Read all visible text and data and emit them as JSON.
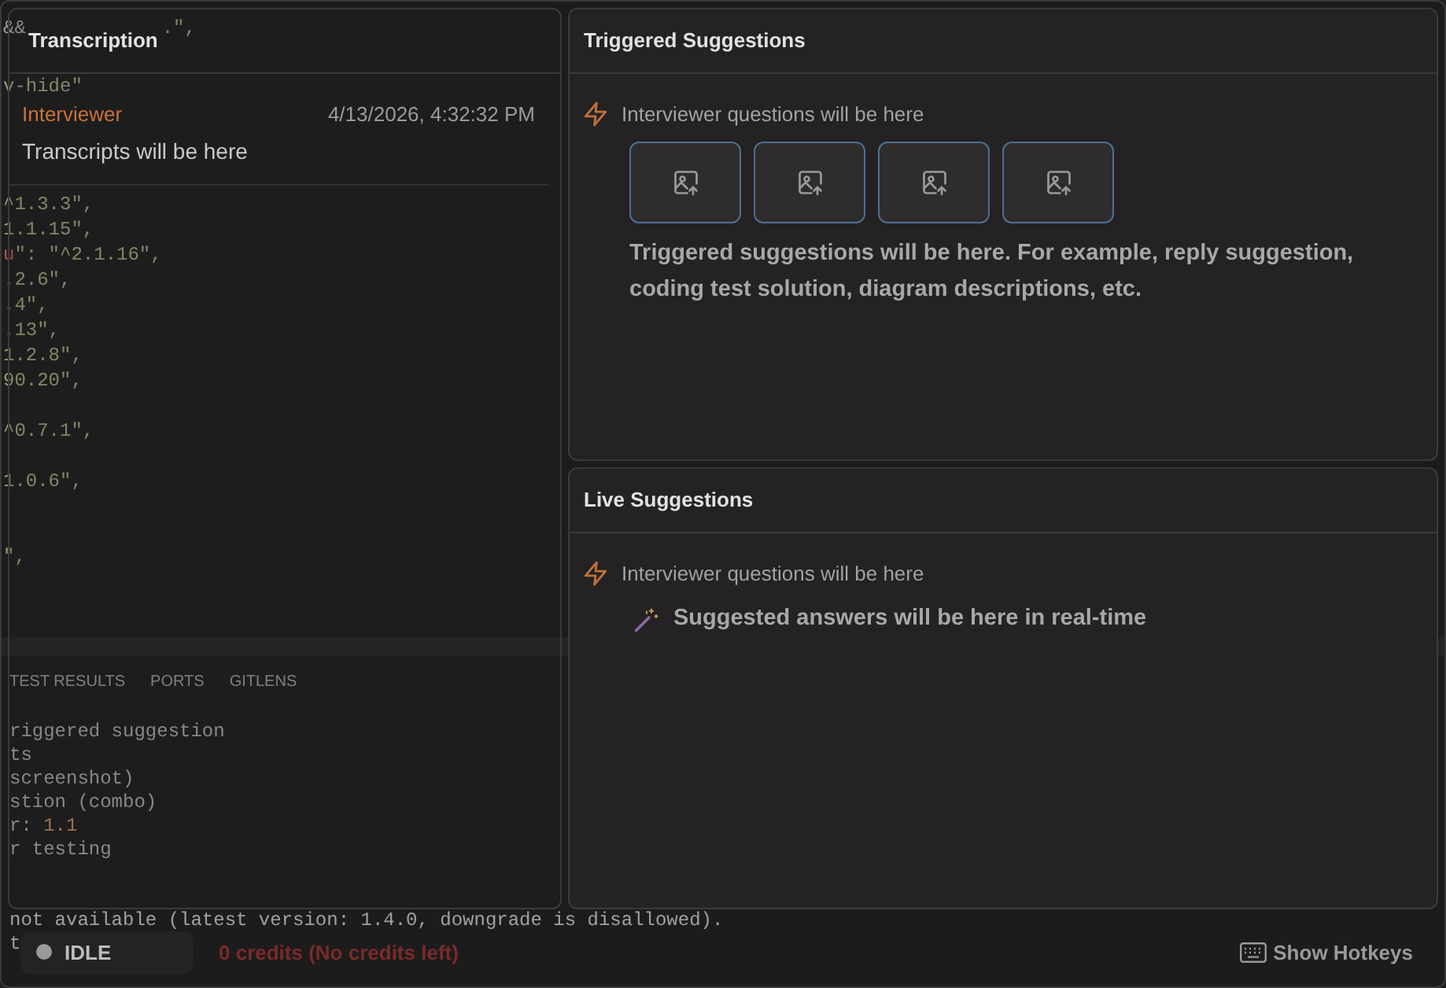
{
  "background_editor": {
    "code_blocks": [
      [
        [
          {
            "text": "&&",
            "kind": "plain"
          },
          {
            "text": "            .\",",
            "kind": "string"
          }
        ]
      ],
      [
        [
          {
            "text": "v-hide\"",
            "kind": "string"
          }
        ]
      ],
      [
        [
          {
            "text": "^1.3.3\",",
            "kind": "string"
          }
        ],
        [
          {
            "text": "1.1.15\",",
            "kind": "string"
          }
        ],
        [
          {
            "text": "u",
            "kind": "key"
          },
          {
            "text": "\": \"^2.1.16\",",
            "kind": "string"
          }
        ],
        [
          {
            "text": ".2.6\",",
            "kind": "string"
          }
        ],
        [
          {
            "text": ".4\",",
            "kind": "string"
          }
        ],
        [
          {
            "text": ".13\",",
            "kind": "string"
          }
        ],
        [
          {
            "text": "1.2.8\",",
            "kind": "string"
          }
        ],
        [
          {
            "text": "90.20\",",
            "kind": "string"
          }
        ]
      ],
      [
        [
          {
            "text": "^0.7.1\",",
            "kind": "string"
          }
        ]
      ],
      [
        [
          {
            "text": "1.0.6\",",
            "kind": "string"
          }
        ]
      ],
      [
        [
          {
            "text": "\",",
            "kind": "string"
          }
        ]
      ]
    ],
    "panel_tabs": [
      "TEST RESULTS",
      "PORTS",
      "GITLENS"
    ],
    "terminal_blocks": [
      [
        [
          {
            "text": "riggered suggestion",
            "kind": "plain"
          }
        ],
        [
          {
            "text": "ts",
            "kind": "plain"
          }
        ],
        [
          {
            "text": "screenshot)",
            "kind": "plain"
          }
        ],
        [
          {
            "text": "stion (combo)",
            "kind": "plain"
          }
        ],
        [
          {
            "text": "r: ",
            "kind": "plain"
          },
          {
            "text": "1.1",
            "kind": "number"
          }
        ],
        [
          {
            "text": "r testing",
            "kind": "plain"
          }
        ]
      ],
      [
        [
          {
            "text": "not available (latest version: 1.4.0, downgrade is disallowed).",
            "kind": "plain"
          }
        ],
        [
          {
            "text": "t",
            "kind": "plain"
          }
        ]
      ]
    ]
  },
  "transcription": {
    "title": "Transcription",
    "entries": [
      {
        "speaker": "Interviewer",
        "time": "4/13/2026, 4:32:32 PM",
        "text": "Transcripts will be here"
      }
    ]
  },
  "triggered_suggestions": {
    "title": "Triggered Suggestions",
    "question": "Interviewer questions will be here",
    "image_slots": [
      {
        "kind": "upload"
      },
      {
        "kind": "upload"
      },
      {
        "kind": "upload"
      },
      {
        "kind": "upload"
      }
    ],
    "message": "Triggered suggestions will be here. For example, reply suggestion, coding test solution, diagram descriptions, etc."
  },
  "live_suggestions": {
    "title": "Live Suggestions",
    "question": "Interviewer questions will be here",
    "message": "Suggested answers will be here in real-time"
  },
  "status_bar": {
    "state": "IDLE",
    "credits": "0 credits (No credits left)",
    "hotkeys": "Show Hotkeys"
  }
}
